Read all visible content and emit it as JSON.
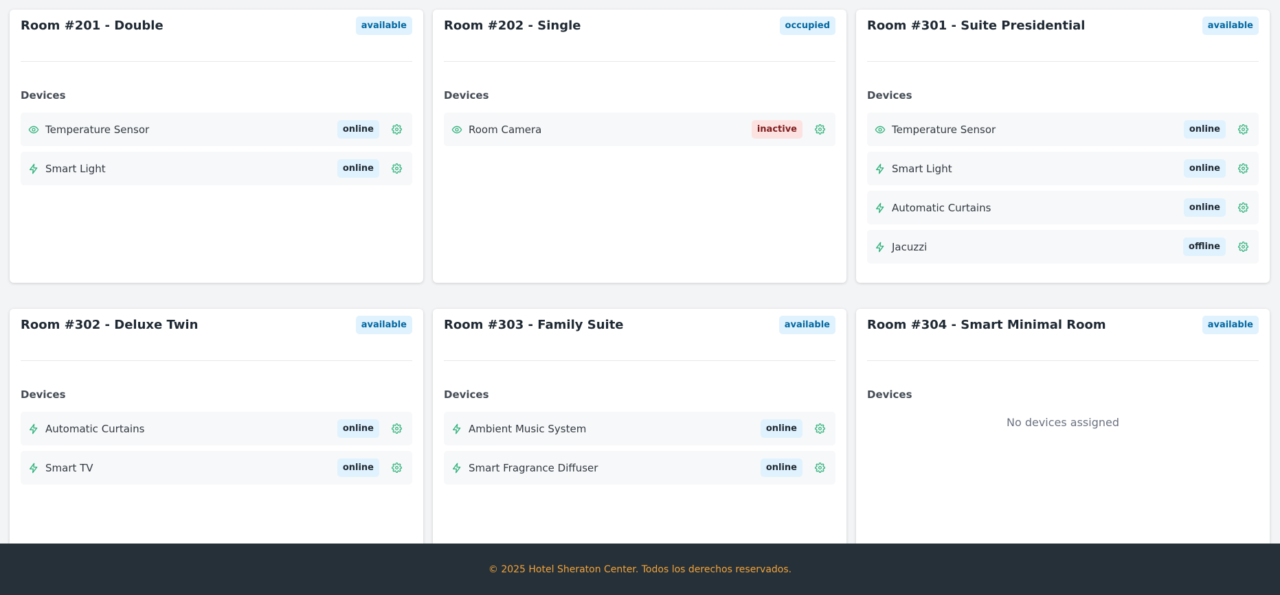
{
  "colors": {
    "accent_green": "#2fb27c",
    "badge_blue_bg": "#e0f2fe",
    "badge_blue_text": "#0369a1",
    "inactive_bg": "#fde2e2",
    "footer_bg": "#263038",
    "footer_text": "#f2a33a"
  },
  "rooms": [
    {
      "title": "Room #201 - Double",
      "status": "available",
      "devices_label": "Devices",
      "devices": [
        {
          "icon": "eye-icon",
          "name": "Temperature Sensor",
          "status": "online"
        },
        {
          "icon": "bolt-icon",
          "name": "Smart Light",
          "status": "online"
        }
      ]
    },
    {
      "title": "Room #202 - Single",
      "status": "occupied",
      "devices_label": "Devices",
      "devices": [
        {
          "icon": "eye-icon",
          "name": "Room Camera",
          "status": "inactive"
        }
      ]
    },
    {
      "title": "Room #301 - Suite Presidential",
      "status": "available",
      "devices_label": "Devices",
      "devices": [
        {
          "icon": "eye-icon",
          "name": "Temperature Sensor",
          "status": "online"
        },
        {
          "icon": "bolt-icon",
          "name": "Smart Light",
          "status": "online"
        },
        {
          "icon": "bolt-icon",
          "name": "Automatic Curtains",
          "status": "online"
        },
        {
          "icon": "bolt-icon",
          "name": "Jacuzzi",
          "status": "offline"
        }
      ]
    },
    {
      "title": "Room #302 - Deluxe Twin",
      "status": "available",
      "devices_label": "Devices",
      "devices": [
        {
          "icon": "bolt-icon",
          "name": "Automatic Curtains",
          "status": "online"
        },
        {
          "icon": "bolt-icon",
          "name": "Smart TV",
          "status": "online"
        }
      ]
    },
    {
      "title": "Room #303 - Family Suite",
      "status": "available",
      "devices_label": "Devices",
      "devices": [
        {
          "icon": "bolt-icon",
          "name": "Ambient Music System",
          "status": "online"
        },
        {
          "icon": "bolt-icon",
          "name": "Smart Fragrance Diffuser",
          "status": "online"
        }
      ]
    },
    {
      "title": "Room #304 - Smart Minimal Room",
      "status": "available",
      "devices_label": "Devices",
      "devices": [],
      "empty_text": "No devices assigned"
    }
  ],
  "footer": {
    "text": "© 2025 Hotel Sheraton Center. Todos los derechos reservados."
  }
}
